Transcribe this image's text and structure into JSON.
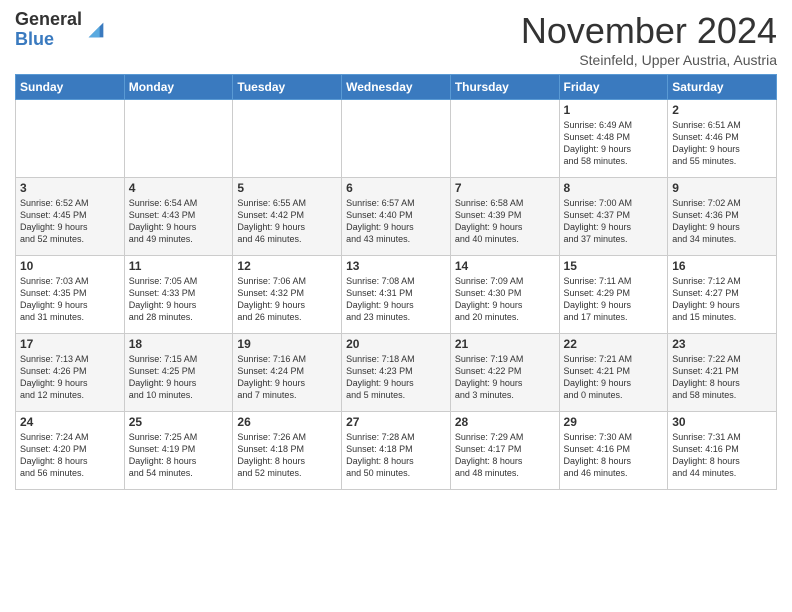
{
  "header": {
    "logo_general": "General",
    "logo_blue": "Blue",
    "month_title": "November 2024",
    "location": "Steinfeld, Upper Austria, Austria"
  },
  "weekdays": [
    "Sunday",
    "Monday",
    "Tuesday",
    "Wednesday",
    "Thursday",
    "Friday",
    "Saturday"
  ],
  "weeks": [
    [
      {
        "day": "",
        "info": ""
      },
      {
        "day": "",
        "info": ""
      },
      {
        "day": "",
        "info": ""
      },
      {
        "day": "",
        "info": ""
      },
      {
        "day": "",
        "info": ""
      },
      {
        "day": "1",
        "info": "Sunrise: 6:49 AM\nSunset: 4:48 PM\nDaylight: 9 hours\nand 58 minutes."
      },
      {
        "day": "2",
        "info": "Sunrise: 6:51 AM\nSunset: 4:46 PM\nDaylight: 9 hours\nand 55 minutes."
      }
    ],
    [
      {
        "day": "3",
        "info": "Sunrise: 6:52 AM\nSunset: 4:45 PM\nDaylight: 9 hours\nand 52 minutes."
      },
      {
        "day": "4",
        "info": "Sunrise: 6:54 AM\nSunset: 4:43 PM\nDaylight: 9 hours\nand 49 minutes."
      },
      {
        "day": "5",
        "info": "Sunrise: 6:55 AM\nSunset: 4:42 PM\nDaylight: 9 hours\nand 46 minutes."
      },
      {
        "day": "6",
        "info": "Sunrise: 6:57 AM\nSunset: 4:40 PM\nDaylight: 9 hours\nand 43 minutes."
      },
      {
        "day": "7",
        "info": "Sunrise: 6:58 AM\nSunset: 4:39 PM\nDaylight: 9 hours\nand 40 minutes."
      },
      {
        "day": "8",
        "info": "Sunrise: 7:00 AM\nSunset: 4:37 PM\nDaylight: 9 hours\nand 37 minutes."
      },
      {
        "day": "9",
        "info": "Sunrise: 7:02 AM\nSunset: 4:36 PM\nDaylight: 9 hours\nand 34 minutes."
      }
    ],
    [
      {
        "day": "10",
        "info": "Sunrise: 7:03 AM\nSunset: 4:35 PM\nDaylight: 9 hours\nand 31 minutes."
      },
      {
        "day": "11",
        "info": "Sunrise: 7:05 AM\nSunset: 4:33 PM\nDaylight: 9 hours\nand 28 minutes."
      },
      {
        "day": "12",
        "info": "Sunrise: 7:06 AM\nSunset: 4:32 PM\nDaylight: 9 hours\nand 26 minutes."
      },
      {
        "day": "13",
        "info": "Sunrise: 7:08 AM\nSunset: 4:31 PM\nDaylight: 9 hours\nand 23 minutes."
      },
      {
        "day": "14",
        "info": "Sunrise: 7:09 AM\nSunset: 4:30 PM\nDaylight: 9 hours\nand 20 minutes."
      },
      {
        "day": "15",
        "info": "Sunrise: 7:11 AM\nSunset: 4:29 PM\nDaylight: 9 hours\nand 17 minutes."
      },
      {
        "day": "16",
        "info": "Sunrise: 7:12 AM\nSunset: 4:27 PM\nDaylight: 9 hours\nand 15 minutes."
      }
    ],
    [
      {
        "day": "17",
        "info": "Sunrise: 7:13 AM\nSunset: 4:26 PM\nDaylight: 9 hours\nand 12 minutes."
      },
      {
        "day": "18",
        "info": "Sunrise: 7:15 AM\nSunset: 4:25 PM\nDaylight: 9 hours\nand 10 minutes."
      },
      {
        "day": "19",
        "info": "Sunrise: 7:16 AM\nSunset: 4:24 PM\nDaylight: 9 hours\nand 7 minutes."
      },
      {
        "day": "20",
        "info": "Sunrise: 7:18 AM\nSunset: 4:23 PM\nDaylight: 9 hours\nand 5 minutes."
      },
      {
        "day": "21",
        "info": "Sunrise: 7:19 AM\nSunset: 4:22 PM\nDaylight: 9 hours\nand 3 minutes."
      },
      {
        "day": "22",
        "info": "Sunrise: 7:21 AM\nSunset: 4:21 PM\nDaylight: 9 hours\nand 0 minutes."
      },
      {
        "day": "23",
        "info": "Sunrise: 7:22 AM\nSunset: 4:21 PM\nDaylight: 8 hours\nand 58 minutes."
      }
    ],
    [
      {
        "day": "24",
        "info": "Sunrise: 7:24 AM\nSunset: 4:20 PM\nDaylight: 8 hours\nand 56 minutes."
      },
      {
        "day": "25",
        "info": "Sunrise: 7:25 AM\nSunset: 4:19 PM\nDaylight: 8 hours\nand 54 minutes."
      },
      {
        "day": "26",
        "info": "Sunrise: 7:26 AM\nSunset: 4:18 PM\nDaylight: 8 hours\nand 52 minutes."
      },
      {
        "day": "27",
        "info": "Sunrise: 7:28 AM\nSunset: 4:18 PM\nDaylight: 8 hours\nand 50 minutes."
      },
      {
        "day": "28",
        "info": "Sunrise: 7:29 AM\nSunset: 4:17 PM\nDaylight: 8 hours\nand 48 minutes."
      },
      {
        "day": "29",
        "info": "Sunrise: 7:30 AM\nSunset: 4:16 PM\nDaylight: 8 hours\nand 46 minutes."
      },
      {
        "day": "30",
        "info": "Sunrise: 7:31 AM\nSunset: 4:16 PM\nDaylight: 8 hours\nand 44 minutes."
      }
    ]
  ]
}
